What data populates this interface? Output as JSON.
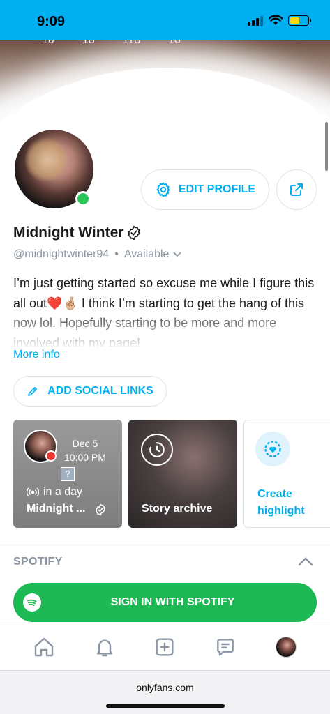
{
  "status_bar": {
    "time": "9:09",
    "battery_level": 0.55,
    "battery_color": "#ffd60a"
  },
  "cover": {
    "stats": [
      "10",
      "18",
      "118",
      "10"
    ]
  },
  "profile": {
    "edit_label": "EDIT PROFILE",
    "name": "Midnight Winter",
    "handle": "@midnightwinter94",
    "separator": "•",
    "availability": "Available",
    "bio": "I’m just getting started so excuse me while I figure this all out❤️🤞🏼 I think I’m starting to get the hang of this now lol. Hopefully starting to be more and more involved with my page!",
    "more_info": "More info",
    "add_social_links": "ADD SOCIAL LINKS",
    "online": true
  },
  "highlights": {
    "story": {
      "date": "Dec 5",
      "time": "10:00 PM",
      "badge": "?",
      "when": "in a day",
      "title": "Midnight ..."
    },
    "archive": {
      "label": "Story archive"
    },
    "create": {
      "label_line1": "Create",
      "label_line2": "highlight"
    }
  },
  "spotify": {
    "heading": "SPOTIFY",
    "button_label": "SIGN IN WITH SPOTIFY",
    "brand_color": "#1db954"
  },
  "bottom_nav": {
    "items": [
      "home-icon",
      "bell-icon",
      "plus-square-icon",
      "chat-icon",
      "avatar"
    ]
  },
  "browser": {
    "url": "onlyfans.com"
  },
  "theme": {
    "accent": "#00aff0",
    "online_color": "#2ac55a"
  }
}
